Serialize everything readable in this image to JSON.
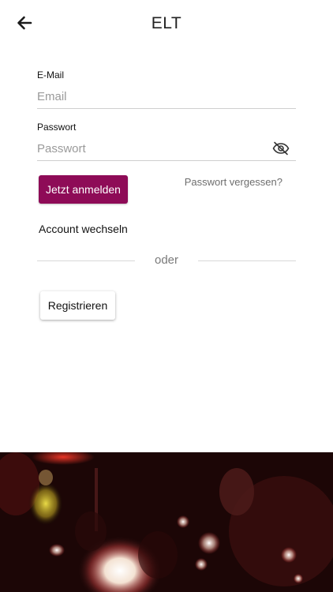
{
  "header": {
    "title": "ELT",
    "back_icon": "arrow-left-icon"
  },
  "login_form": {
    "email": {
      "label": "E-Mail",
      "placeholder": "Email",
      "value": ""
    },
    "password": {
      "label": "Passwort",
      "placeholder": "Passwort",
      "value": "",
      "toggle_icon": "eye-off-icon"
    },
    "login_button_label": "Jetzt anmelden",
    "forgot_password_label": "Passwort vergessen?",
    "switch_account_label": "Account wechseln"
  },
  "divider": {
    "text": "oder"
  },
  "register": {
    "button_label": "Registrieren"
  },
  "colors": {
    "accent": "#8e0b57",
    "background": "#ffffff"
  }
}
